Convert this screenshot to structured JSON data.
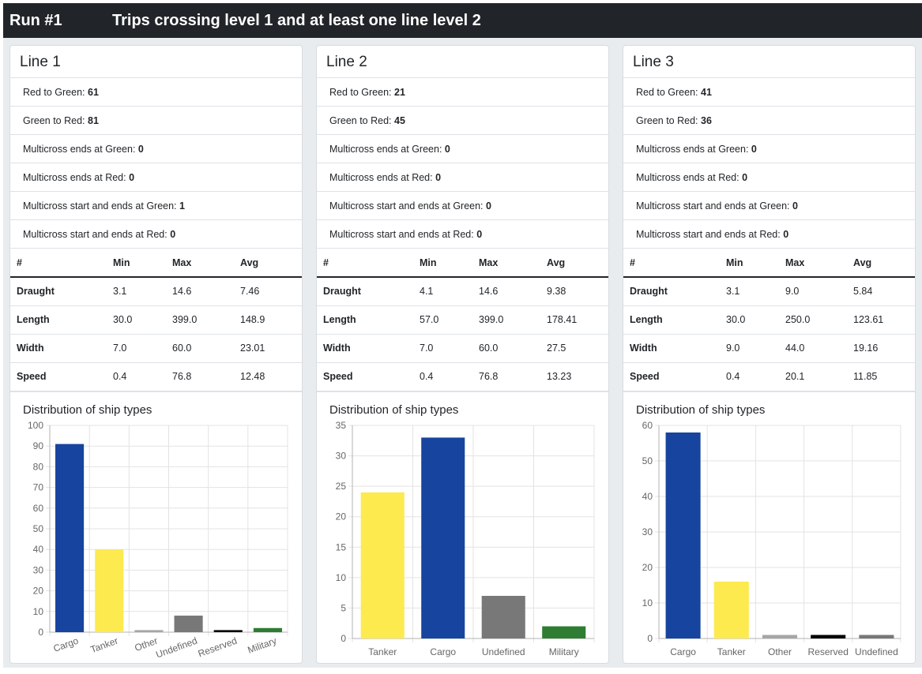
{
  "header": {
    "run_label": "Run #1",
    "title": "Trips crossing level 1 and at least one line level 2"
  },
  "table_headers": {
    "name": "#",
    "min": "Min",
    "max": "Max",
    "avg": "Avg"
  },
  "stat_labels": [
    "Red to Green:",
    "Green to Red:",
    "Multicross ends at Green:",
    "Multicross ends at Red:",
    "Multicross start and ends at Green:",
    "Multicross start and ends at Red:"
  ],
  "colors": {
    "Cargo": "#17449e",
    "Tanker": "#fcea4f",
    "Other": "#a6a6a6",
    "Undefined": "#787878",
    "Reserved": "#000000",
    "Military": "#2e7d32"
  },
  "cards": [
    {
      "title": "Line 1",
      "stats": [
        "61",
        "81",
        "0",
        "0",
        "1",
        "0"
      ],
      "metrics": [
        {
          "name": "Draught",
          "min": "3.1",
          "max": "14.6",
          "avg": "7.46"
        },
        {
          "name": "Length",
          "min": "30.0",
          "max": "399.0",
          "avg": "148.9"
        },
        {
          "name": "Width",
          "min": "7.0",
          "max": "60.0",
          "avg": "23.01"
        },
        {
          "name": "Speed",
          "min": "0.4",
          "max": "76.8",
          "avg": "12.48"
        }
      ],
      "chart_title": "Distribution of ship types"
    },
    {
      "title": "Line 2",
      "stats": [
        "21",
        "45",
        "0",
        "0",
        "0",
        "0"
      ],
      "metrics": [
        {
          "name": "Draught",
          "min": "4.1",
          "max": "14.6",
          "avg": "9.38"
        },
        {
          "name": "Length",
          "min": "57.0",
          "max": "399.0",
          "avg": "178.41"
        },
        {
          "name": "Width",
          "min": "7.0",
          "max": "60.0",
          "avg": "27.5"
        },
        {
          "name": "Speed",
          "min": "0.4",
          "max": "76.8",
          "avg": "13.23"
        }
      ],
      "chart_title": "Distribution of ship types"
    },
    {
      "title": "Line 3",
      "stats": [
        "41",
        "36",
        "0",
        "0",
        "0",
        "0"
      ],
      "metrics": [
        {
          "name": "Draught",
          "min": "3.1",
          "max": "9.0",
          "avg": "5.84"
        },
        {
          "name": "Length",
          "min": "30.0",
          "max": "250.0",
          "avg": "123.61"
        },
        {
          "name": "Width",
          "min": "9.0",
          "max": "44.0",
          "avg": "19.16"
        },
        {
          "name": "Speed",
          "min": "0.4",
          "max": "20.1",
          "avg": "11.85"
        }
      ],
      "chart_title": "Distribution of ship types"
    }
  ],
  "chart_data": [
    {
      "type": "bar",
      "title": "Distribution of ship types",
      "categories": [
        "Cargo",
        "Tanker",
        "Other",
        "Undefined",
        "Reserved",
        "Military"
      ],
      "values": [
        91,
        40,
        1,
        8,
        1,
        2
      ],
      "ylim": [
        0,
        100
      ],
      "yticks": [
        0,
        10,
        20,
        30,
        40,
        50,
        60,
        70,
        80,
        90,
        100
      ],
      "rotated_labels": true,
      "grid": true
    },
    {
      "type": "bar",
      "title": "Distribution of ship types",
      "categories": [
        "Tanker",
        "Cargo",
        "Undefined",
        "Military"
      ],
      "values": [
        24,
        33,
        7,
        2
      ],
      "ylim": [
        0,
        35
      ],
      "yticks": [
        0,
        5,
        10,
        15,
        20,
        25,
        30,
        35
      ],
      "rotated_labels": false,
      "grid": true
    },
    {
      "type": "bar",
      "title": "Distribution of ship types",
      "categories": [
        "Cargo",
        "Tanker",
        "Other",
        "Reserved",
        "Undefined"
      ],
      "values": [
        58,
        16,
        1,
        1,
        1
      ],
      "ylim": [
        0,
        60
      ],
      "yticks": [
        0,
        10,
        20,
        30,
        40,
        50,
        60
      ],
      "rotated_labels": false,
      "grid": true
    }
  ]
}
